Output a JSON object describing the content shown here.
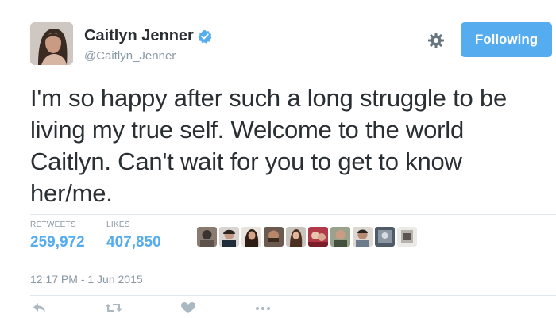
{
  "user": {
    "display_name": "Caitlyn Jenner",
    "handle": "@Caitlyn_Jenner",
    "verified_icon": "verified-badge-icon"
  },
  "header": {
    "settings_icon": "gear-icon",
    "follow_label": "Following"
  },
  "tweet": {
    "text": "I'm so happy after such a long struggle to be\nliving my true self. Welcome to the world\nCaitlyn. Can't wait for you to get to know\nher/me."
  },
  "stats": {
    "retweets_label": "RETWEETS",
    "retweets_value": "259,972",
    "likes_label": "LIKES",
    "likes_value": "407,850"
  },
  "likers": [
    "avatar",
    "avatar",
    "avatar",
    "avatar",
    "avatar",
    "avatar",
    "avatar",
    "avatar",
    "avatar",
    "avatar"
  ],
  "timestamp": "12:17 PM - 1 Jun 2015",
  "actions": [
    "reply-icon",
    "retweet-icon",
    "like-icon",
    "more-icon"
  ],
  "colors": {
    "accent": "#55acee",
    "muted": "#8899a6",
    "text": "#292f33",
    "divider": "#e1e8ed"
  }
}
